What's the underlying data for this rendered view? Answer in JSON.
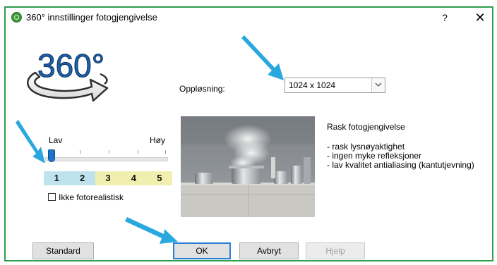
{
  "dialog": {
    "title": "360° innstillinger fotogjengivelse",
    "help_glyph": "?",
    "close_glyph": "✕"
  },
  "logo": {
    "text": "360°"
  },
  "resolution": {
    "label": "Oppløsning:",
    "selected": "1024 x 1024"
  },
  "quality": {
    "low_label": "Lav",
    "high_label": "Høy",
    "slider_value": 1,
    "levels": [
      {
        "label": "1",
        "color": "#bfe3ee"
      },
      {
        "label": "2",
        "color": "#bfe3ee"
      },
      {
        "label": "3",
        "color": "#f0efb0"
      },
      {
        "label": "4",
        "color": "#f0efb0"
      },
      {
        "label": "5",
        "color": "#f0efb0"
      }
    ]
  },
  "non_photorealistic": {
    "label": "Ikke fotorealistisk",
    "checked": false
  },
  "description": {
    "title": "Rask fotogjengivelse",
    "items": [
      "- rask lysnøyaktighet",
      "- ingen myke refleksjoner",
      "- lav kvalitet antialiasing (kantutjevning)"
    ]
  },
  "buttons": {
    "standard": "Standard",
    "ok": "OK",
    "cancel": "Avbryt",
    "help": "Hjelp"
  },
  "colors": {
    "dialog_border": "#2e9e4f",
    "annotation_arrow": "#29a8e0",
    "logo_blue": "#1d5fa8"
  }
}
